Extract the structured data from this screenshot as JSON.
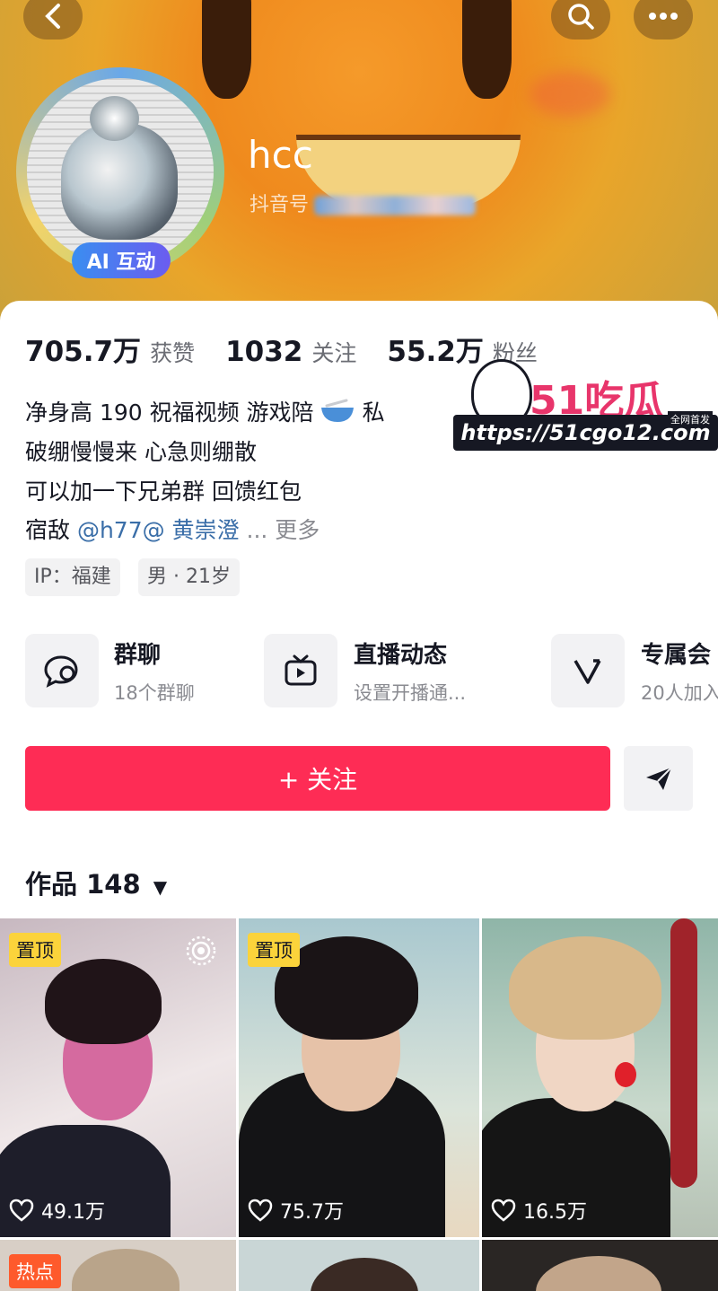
{
  "header": {
    "username": "hcc",
    "douyin_id_label": "抖音号",
    "ai_badge": "AI 互动"
  },
  "stats": [
    {
      "value": "705.7万",
      "label": "获赞"
    },
    {
      "value": "1032",
      "label": "关注"
    },
    {
      "value": "55.2万",
      "label": "粉丝"
    }
  ],
  "bio": {
    "line1": "净身高 190 祝福视频  游戏陪",
    "line1_end": "私",
    "line2": "破绷慢慢来 心急则绷散",
    "line3": "可以加一下兄弟群 回馈红包",
    "line4_prefix": "宿敌 ",
    "line4_mention": "@h77@ 黄崇澄",
    "line4_more": " ...  更多"
  },
  "tags": [
    "IP：福建",
    "男 · 21岁"
  ],
  "features": [
    {
      "title": "群聊",
      "subtitle": "18个群聊",
      "icon": "chat-icon"
    },
    {
      "title": "直播动态",
      "subtitle": "设置开播通...",
      "icon": "tv-icon"
    },
    {
      "title": "专属会",
      "subtitle": "20人加入",
      "icon": "vip-icon"
    }
  ],
  "follow_label": "+ 关注",
  "works": {
    "label": "作品 148"
  },
  "videos": [
    {
      "badge": "置顶",
      "likes": "49.1万"
    },
    {
      "badge": "置顶",
      "likes": "75.7万"
    },
    {
      "badge": "",
      "likes": "16.5万"
    },
    {
      "badge": "热点",
      "likes": ""
    }
  ],
  "watermark": {
    "logo": "51吃瓜",
    "url": "https://51cgo12.com",
    "small": "全网首发"
  },
  "colors": {
    "accent": "#fe2c55",
    "pin": "#fbd33b",
    "mention": "#3a6ea8"
  }
}
